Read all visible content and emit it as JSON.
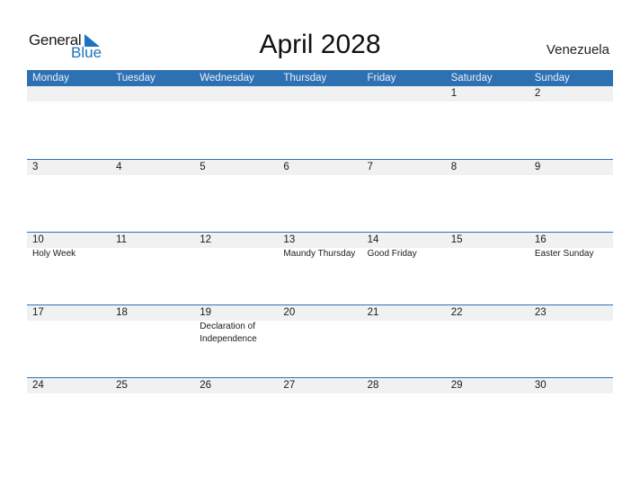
{
  "logo": {
    "word1": "General",
    "word2": "Blue",
    "accent_color": "#1e73be"
  },
  "title": "April 2028",
  "country": "Venezuela",
  "colors": {
    "header_bg": "#2e71b3",
    "date_strip_bg": "#f1f1f1"
  },
  "weekdays": [
    "Monday",
    "Tuesday",
    "Wednesday",
    "Thursday",
    "Friday",
    "Saturday",
    "Sunday"
  ],
  "weeks": [
    {
      "days": [
        {
          "date": "",
          "holiday": ""
        },
        {
          "date": "",
          "holiday": ""
        },
        {
          "date": "",
          "holiday": ""
        },
        {
          "date": "",
          "holiday": ""
        },
        {
          "date": "",
          "holiday": ""
        },
        {
          "date": "1",
          "holiday": ""
        },
        {
          "date": "2",
          "holiday": ""
        }
      ]
    },
    {
      "days": [
        {
          "date": "3",
          "holiday": ""
        },
        {
          "date": "4",
          "holiday": ""
        },
        {
          "date": "5",
          "holiday": ""
        },
        {
          "date": "6",
          "holiday": ""
        },
        {
          "date": "7",
          "holiday": ""
        },
        {
          "date": "8",
          "holiday": ""
        },
        {
          "date": "9",
          "holiday": ""
        }
      ]
    },
    {
      "days": [
        {
          "date": "10",
          "holiday": "Holy Week"
        },
        {
          "date": "11",
          "holiday": ""
        },
        {
          "date": "12",
          "holiday": ""
        },
        {
          "date": "13",
          "holiday": "Maundy Thursday"
        },
        {
          "date": "14",
          "holiday": "Good Friday"
        },
        {
          "date": "15",
          "holiday": ""
        },
        {
          "date": "16",
          "holiday": "Easter Sunday"
        }
      ]
    },
    {
      "days": [
        {
          "date": "17",
          "holiday": ""
        },
        {
          "date": "18",
          "holiday": ""
        },
        {
          "date": "19",
          "holiday": "Declaration of Independence"
        },
        {
          "date": "20",
          "holiday": ""
        },
        {
          "date": "21",
          "holiday": ""
        },
        {
          "date": "22",
          "holiday": ""
        },
        {
          "date": "23",
          "holiday": ""
        }
      ]
    },
    {
      "days": [
        {
          "date": "24",
          "holiday": ""
        },
        {
          "date": "25",
          "holiday": ""
        },
        {
          "date": "26",
          "holiday": ""
        },
        {
          "date": "27",
          "holiday": ""
        },
        {
          "date": "28",
          "holiday": ""
        },
        {
          "date": "29",
          "holiday": ""
        },
        {
          "date": "30",
          "holiday": ""
        }
      ]
    }
  ]
}
